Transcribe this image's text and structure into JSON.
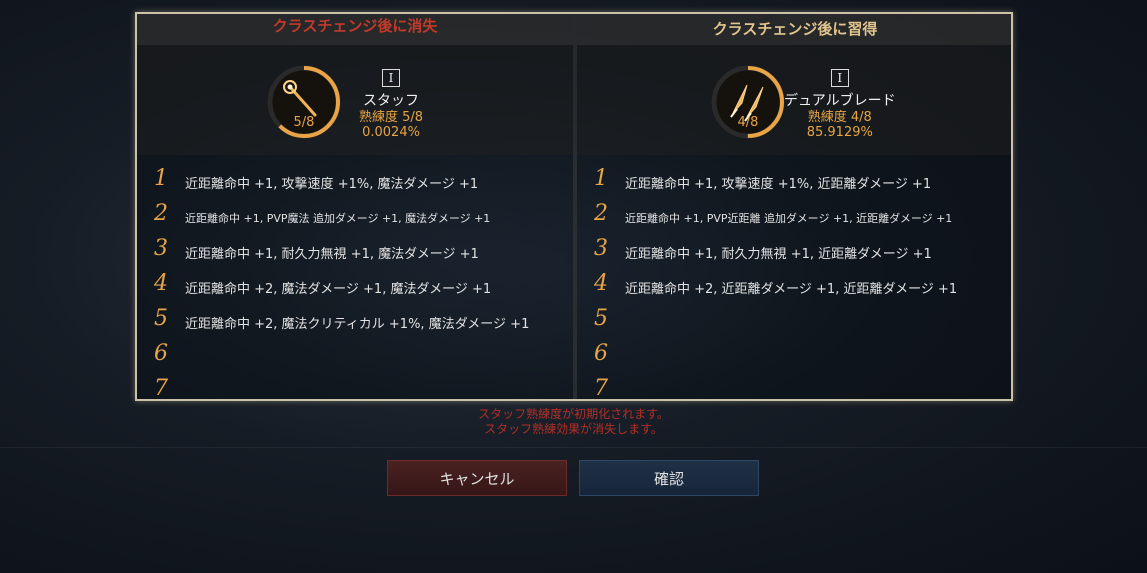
{
  "left": {
    "header": "クラスチェンジ後に消失",
    "weapon": {
      "tier": "I",
      "name": "スタッフ",
      "proficiency": "熟練度 5/8",
      "percent": "0.0024%",
      "ring_label": "5/8",
      "icon": "staff-icon",
      "ring_fraction": 0.625
    },
    "rows": [
      {
        "num": "1",
        "text": "近距離命中 +1, 攻撃速度 +1%, 魔法ダメージ +1"
      },
      {
        "num": "2",
        "text": "近距離命中 +1, PVP魔法 追加ダメージ +1, 魔法ダメージ +1"
      },
      {
        "num": "3",
        "text": "近距離命中 +1, 耐久力無視 +1, 魔法ダメージ +1"
      },
      {
        "num": "4",
        "text": "近距離命中 +2, 魔法ダメージ +1, 魔法ダメージ +1"
      },
      {
        "num": "5",
        "text": "近距離命中 +2, 魔法クリティカル +1%, 魔法ダメージ +1"
      },
      {
        "num": "6",
        "text": ""
      },
      {
        "num": "7",
        "text": ""
      }
    ]
  },
  "right": {
    "header": "クラスチェンジ後に習得",
    "weapon": {
      "tier": "I",
      "name": "デュアルブレード",
      "proficiency": "熟練度 4/8",
      "percent": "85.9129%",
      "ring_label": "4/8",
      "icon": "dual-blade-icon",
      "ring_fraction": 0.5
    },
    "rows": [
      {
        "num": "1",
        "text": "近距離命中 +1, 攻撃速度 +1%, 近距離ダメージ +1"
      },
      {
        "num": "2",
        "text": "近距離命中 +1, PVP近距離 追加ダメージ +1, 近距離ダメージ +1"
      },
      {
        "num": "3",
        "text": "近距離命中 +1, 耐久力無視 +1, 近距離ダメージ +1"
      },
      {
        "num": "4",
        "text": "近距離命中 +2, 近距離ダメージ +1, 近距離ダメージ +1"
      },
      {
        "num": "5",
        "text": ""
      },
      {
        "num": "6",
        "text": ""
      },
      {
        "num": "7",
        "text": ""
      }
    ]
  },
  "warning": {
    "line1": "スタッフ熟練度が初期化されます。",
    "line2": "スタッフ熟練効果が消失します。"
  },
  "buttons": {
    "cancel": "キャンセル",
    "confirm": "確認"
  },
  "colors": {
    "accent_gold": "#e8a447",
    "lost_red": "#c23a2a",
    "gain_gold": "#e1c48e",
    "frame": "#c9c2a6"
  }
}
